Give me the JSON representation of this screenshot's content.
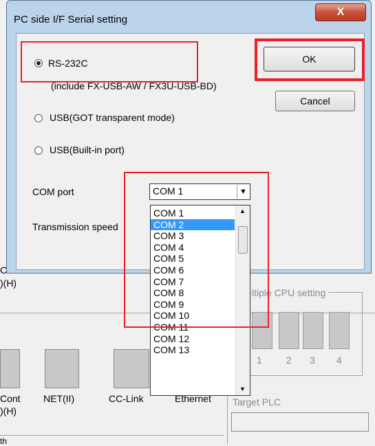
{
  "dialog": {
    "title": "PC side I/F  Serial setting",
    "close_label": "X",
    "options": [
      {
        "label": "RS-232C",
        "selected": true
      },
      {
        "label": "USB(GOT transparent mode)",
        "selected": false
      },
      {
        "label": "USB(Built-in port)",
        "selected": false
      }
    ],
    "rs232c_note": "(include FX-USB-AW / FX3U-USB-BD)",
    "ok_label": "OK",
    "cancel_label": "Cancel",
    "com_port_label": "COM port",
    "com_port_value": "COM 1",
    "transmission_speed_label": "Transmission speed",
    "com_options": [
      "COM 1",
      "COM 2",
      "COM 3",
      "COM 4",
      "COM 5",
      "COM 6",
      "COM 7",
      "COM 8",
      "COM 9",
      "COM 10",
      "COM 11",
      "COM 12",
      "COM 13"
    ],
    "highlighted_option": "COM 2"
  },
  "background": {
    "left_fragment_top": ")(H)",
    "left_fragment_mid": "C",
    "multiple_cpu_label": "ltiple CPU setting",
    "cpu_numbers": [
      "1",
      "2",
      "3",
      "4"
    ],
    "tiles": [
      {
        "label": "Cont",
        "sublabel": ")(H)"
      },
      {
        "label": "NET(II)"
      },
      {
        "label": "CC-Link"
      },
      {
        "label": "Ethernet"
      }
    ],
    "target_plc_label": "Target PLC",
    "bottom_fragment": "th"
  },
  "colors": {
    "highlight": "#3399ff",
    "annotation": "#e8202a",
    "titlebar": "#bcd3ec"
  }
}
